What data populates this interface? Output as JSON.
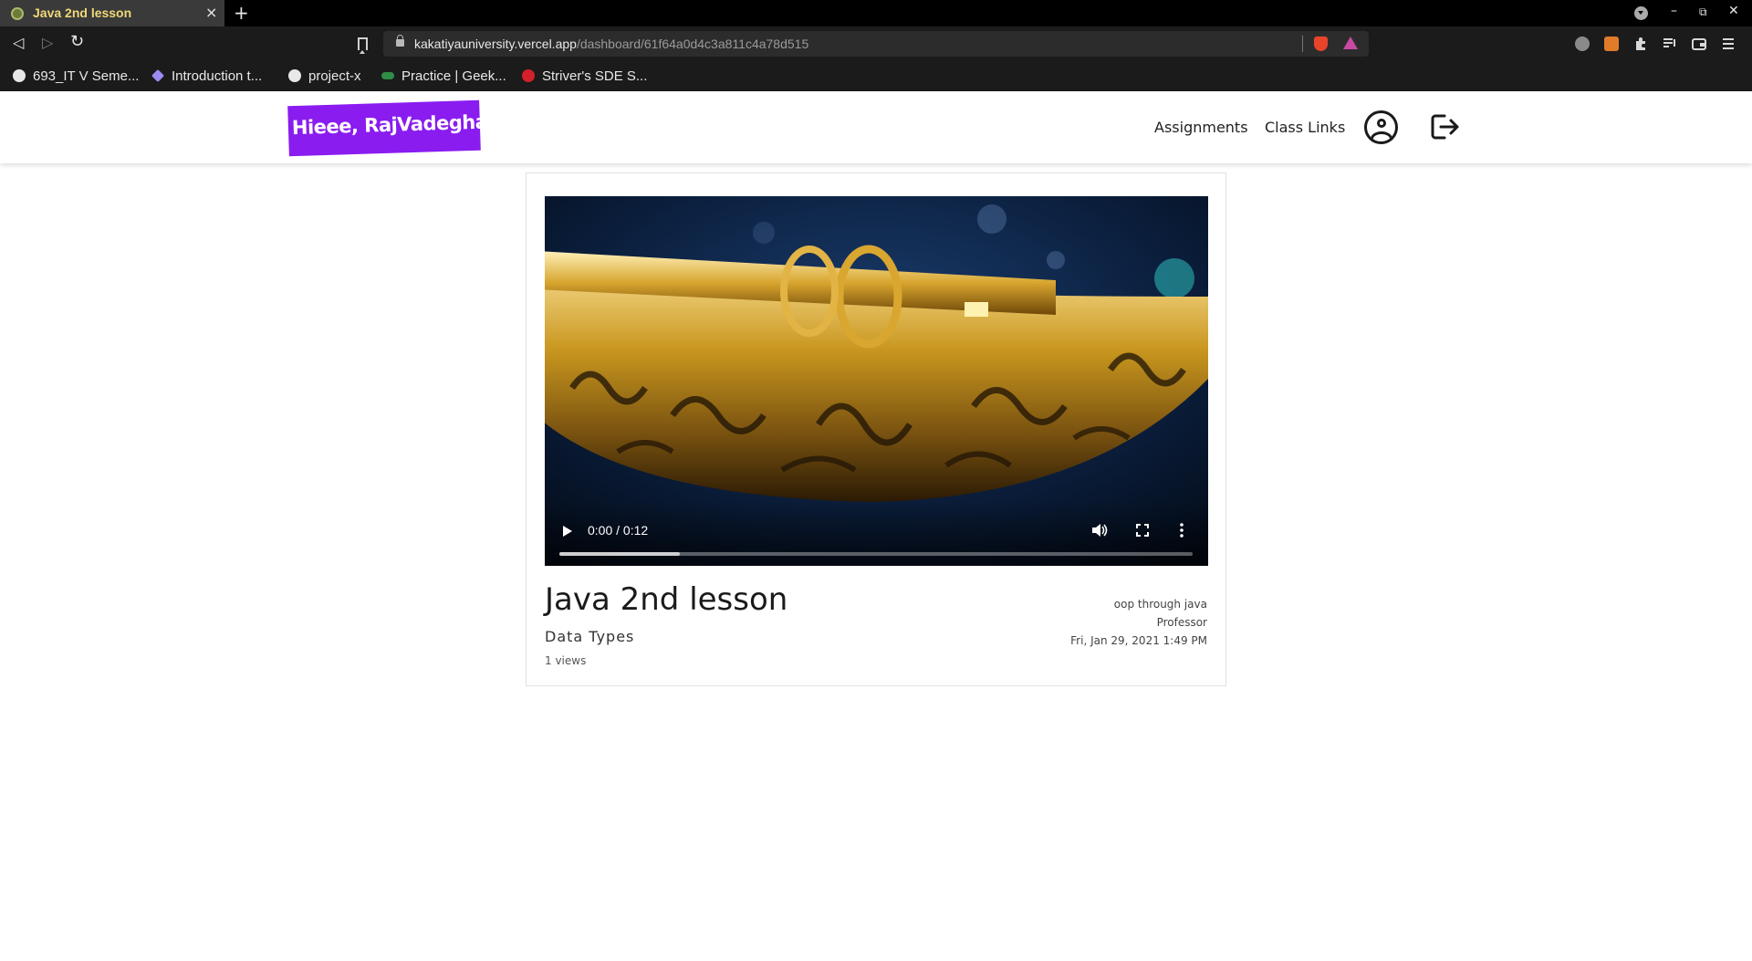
{
  "browser": {
    "tab": {
      "title": "Java 2nd lesson",
      "close": "×"
    },
    "new_tab": "+",
    "window_controls": {
      "minimize": "–",
      "restore": "⧉",
      "close": "✕"
    },
    "nav": {
      "back": "◁",
      "forward": "▷",
      "reload": "↻"
    },
    "url": {
      "host": "kakatiyauniversity.vercel.app",
      "path": "/dashboard/61f64a0d4c3a811c4a78d515"
    },
    "bookmarks": [
      {
        "label": "693_IT V Seme...",
        "icon": "globe-icon",
        "color": "#e8e8e8"
      },
      {
        "label": "Introduction t...",
        "icon": "ethereum-icon",
        "color": "#9b8cf0"
      },
      {
        "label": "project-x",
        "icon": "github-icon",
        "color": "#e8e8e8"
      },
      {
        "label": "Practice | Geek...",
        "icon": "geeksforgeeks-icon",
        "color": "#2f8d46"
      },
      {
        "label": "Striver's SDE S...",
        "icon": "tuf-icon",
        "color": "#d4202a"
      }
    ]
  },
  "navbar": {
    "brand": "Hieee, RajVadeghar",
    "brand_color": "#8a1cf0",
    "links": [
      "Assignments",
      "Class Links"
    ]
  },
  "video": {
    "time": "0:00 / 0:12",
    "buffered_fraction": 0.19
  },
  "lesson": {
    "title": "Java 2nd lesson",
    "topic": "Data Types",
    "views": "1 views",
    "subject": "oop through java",
    "author_role": "Professor",
    "date": "Fri, Jan 29, 2021 1:49 PM"
  }
}
